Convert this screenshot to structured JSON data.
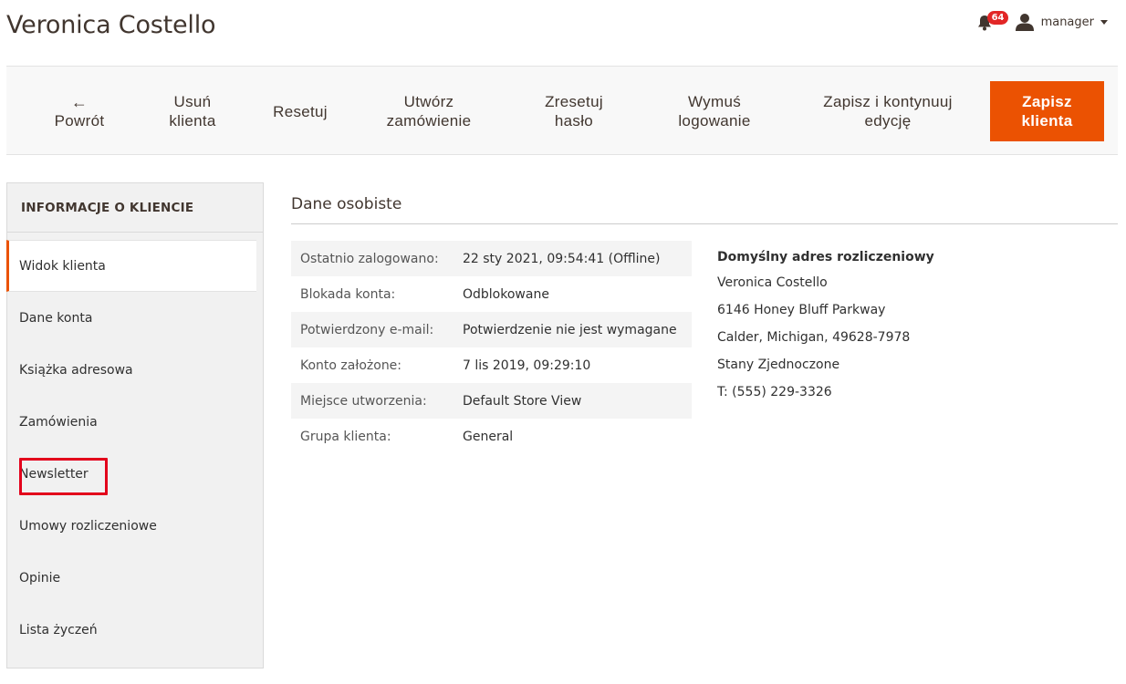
{
  "page_title": "Veronica Costello",
  "header": {
    "notifications_count": "64",
    "user_name": "manager"
  },
  "toolbar": {
    "back_icon": "←",
    "back_label": "Powrót",
    "delete_line1": "Usuń",
    "delete_line2": "klienta",
    "reset_label": "Resetuj",
    "create_order_line1": "Utwórz",
    "create_order_line2": "zamówienie",
    "reset_password_line1": "Zresetuj",
    "reset_password_line2": "hasło",
    "force_logout_line1": "Wymuś",
    "force_logout_line2": "logowanie",
    "save_continue_line1": "Zapisz i kontynuuj",
    "save_continue_line2": "edycję",
    "save_line1": "Zapisz",
    "save_line2": "klienta",
    "accent_color": "#eb5202"
  },
  "sidebar": {
    "title": "INFORMACJE O KLIENCIE",
    "items": [
      {
        "label": "Widok klienta",
        "active": true
      },
      {
        "label": "Dane konta"
      },
      {
        "label": "Książka adresowa"
      },
      {
        "label": "Zamówienia"
      },
      {
        "label": "Newsletter",
        "highlighted": true
      },
      {
        "label": "Umowy rozliczeniowe"
      },
      {
        "label": "Opinie"
      },
      {
        "label": "Lista życzeń"
      }
    ]
  },
  "main": {
    "section_title": "Dane osobiste",
    "info_rows": [
      {
        "label": "Ostatnio zalogowano:",
        "value": "22 sty 2021, 09:54:41 (Offline)"
      },
      {
        "label": "Blokada konta:",
        "value": "Odblokowane"
      },
      {
        "label": "Potwierdzony e-mail:",
        "value": "Potwierdzenie nie jest wymagane"
      },
      {
        "label": "Konto założone:",
        "value": "7 lis 2019, 09:29:10"
      },
      {
        "label": "Miejsce utworzenia:",
        "value": "Default Store View"
      },
      {
        "label": "Grupa klienta:",
        "value": "General"
      }
    ],
    "address": {
      "title": "Domyślny adres rozliczeniowy",
      "lines": [
        "Veronica Costello",
        "6146 Honey Bluff Parkway",
        "Calder, Michigan, 49628-7978",
        "Stany Zjednoczone",
        "T: (555) 229-3326"
      ]
    }
  }
}
